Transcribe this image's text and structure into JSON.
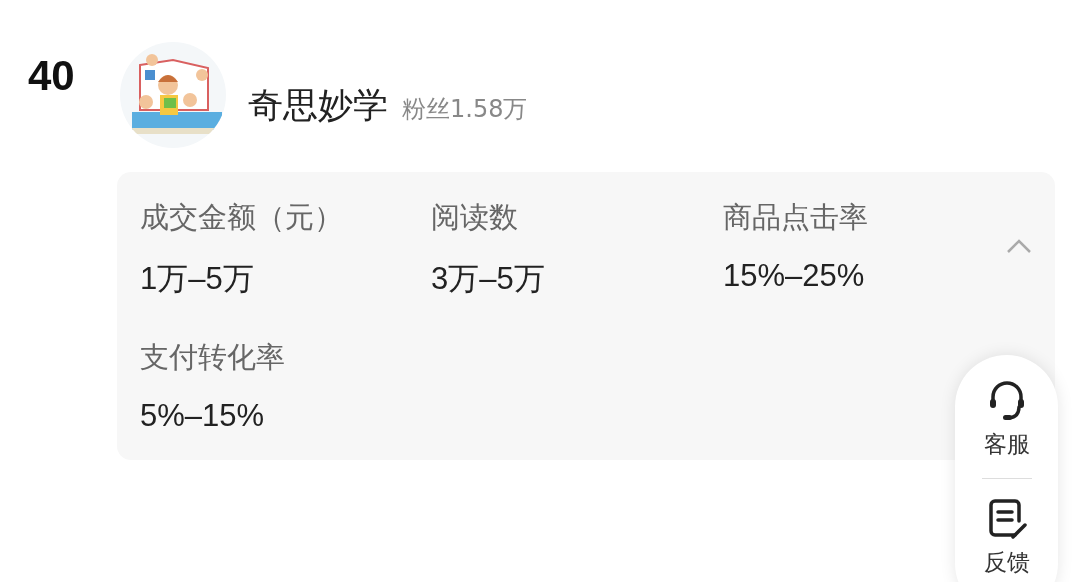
{
  "rank": "40",
  "account": {
    "name": "奇思妙学",
    "fans": "粉丝1.58万"
  },
  "stats": {
    "expanded": true,
    "items": [
      {
        "label": "成交金额（元）",
        "value": "1万–5万"
      },
      {
        "label": "阅读数",
        "value": "3万–5万"
      },
      {
        "label": "商品点击率",
        "value": "15%–25%"
      },
      {
        "label": "支付转化率",
        "value": "5%–15%"
      }
    ]
  },
  "float_panel": [
    {
      "kind": "service",
      "label": "客服"
    },
    {
      "kind": "feedback",
      "label": "反馈"
    }
  ]
}
